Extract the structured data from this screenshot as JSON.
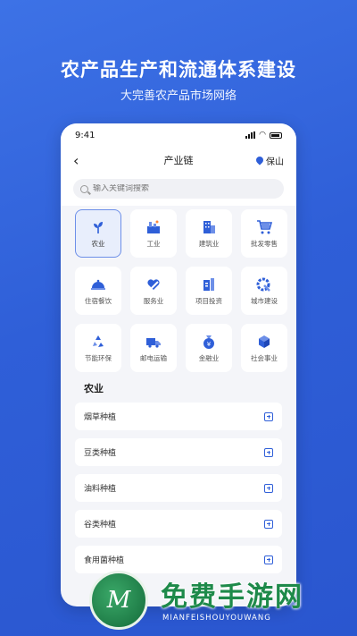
{
  "hero": {
    "title": "农产品生产和流通体系建设",
    "subtitle": "大完善农产品市场网络"
  },
  "status": {
    "time": "9:41"
  },
  "nav": {
    "back_icon": "chevron-left-icon",
    "title": "产业链",
    "location": "保山"
  },
  "search": {
    "placeholder": "输入关键词搜索"
  },
  "categories": [
    {
      "label": "农业",
      "icon": "sprout-icon",
      "active": true
    },
    {
      "label": "工业",
      "icon": "factory-icon"
    },
    {
      "label": "建筑业",
      "icon": "building-icon"
    },
    {
      "label": "批发零售",
      "icon": "cart-icon"
    },
    {
      "label": "住宿餐饮",
      "icon": "dish-cover-icon"
    },
    {
      "label": "服务业",
      "icon": "heart-hand-icon"
    },
    {
      "label": "项目投资",
      "icon": "chart-building-icon"
    },
    {
      "label": "城市建设",
      "icon": "gear-wrench-icon"
    },
    {
      "label": "节能环保",
      "icon": "recycle-icon"
    },
    {
      "label": "邮电运输",
      "icon": "truck-icon"
    },
    {
      "label": "金融业",
      "icon": "money-bag-icon"
    },
    {
      "label": "社会事业",
      "icon": "cube-icon"
    }
  ],
  "section": {
    "title": "农业"
  },
  "list": [
    {
      "name": "烟草种植"
    },
    {
      "name": "豆类种植"
    },
    {
      "name": "油料种植"
    },
    {
      "name": "谷类种植"
    },
    {
      "name": "食用菌种植"
    }
  ],
  "watermark": {
    "text": "免费手游网",
    "sub": "MIANFEISHOUYOUWANG",
    "logo_letter": "M"
  },
  "colors": {
    "accent": "#2f5fd8",
    "background": "#3d72e6",
    "watermark_green": "#1e8a4a"
  }
}
